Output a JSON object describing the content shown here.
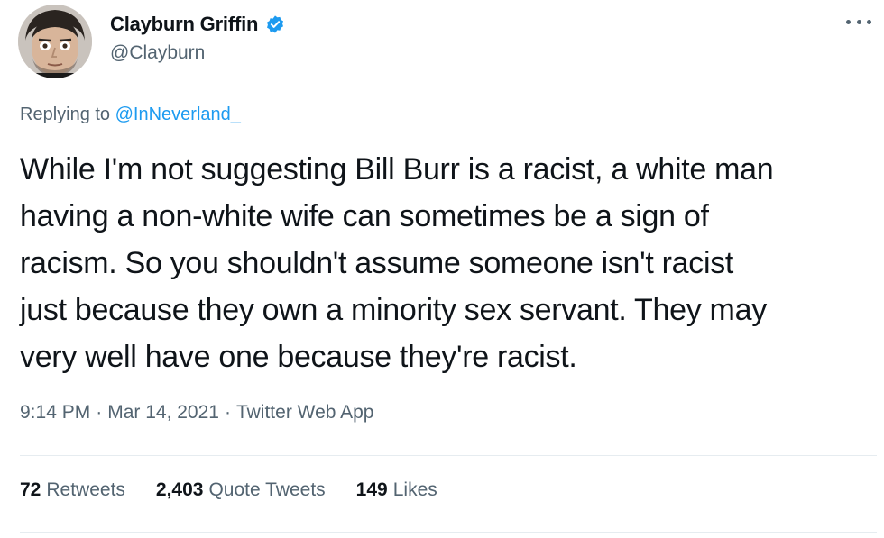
{
  "author": {
    "display_name": "Clayburn Griffin",
    "handle": "@Clayburn",
    "verified_icon": "verified-badge-icon",
    "verified_color": "#1d9bf0"
  },
  "reply": {
    "prefix": "Replying to",
    "target": "@InNeverland_"
  },
  "tweet": {
    "text": "While I'm not suggesting Bill Burr is a racist, a white man\nhaving a non-white wife can sometimes be a sign of\nracism.  So you shouldn't assume someone isn't racist\njust because they own a minority sex servant.   They may\nvery well have one because they're racist."
  },
  "meta": {
    "time": "9:14 PM",
    "separator": "·",
    "date": "Mar 14, 2021",
    "source": "Twitter Web App"
  },
  "stats": [
    {
      "count": "72",
      "label": "Retweets"
    },
    {
      "count": "2,403",
      "label": "Quote Tweets"
    },
    {
      "count": "149",
      "label": "Likes"
    }
  ],
  "colors": {
    "text_primary": "#0f1419",
    "text_secondary": "#536471",
    "link": "#1d9bf0",
    "divider": "#e6ecf0"
  }
}
